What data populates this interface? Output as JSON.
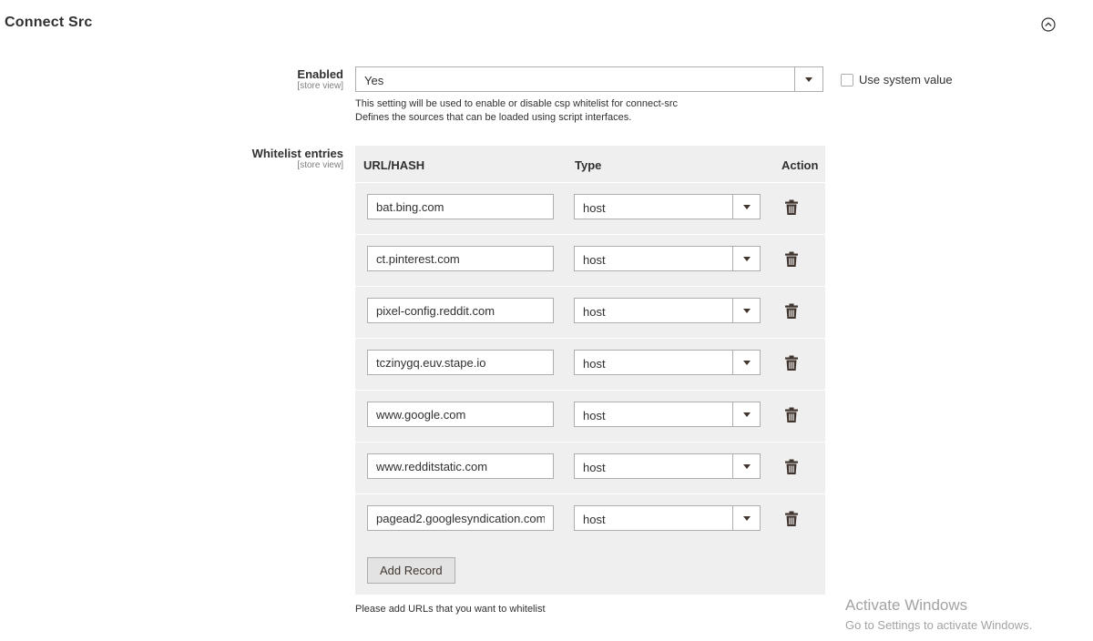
{
  "section": {
    "title": "Connect Src",
    "collapse_icon": "chevron-up-circle-icon"
  },
  "enabled_field": {
    "label": "Enabled",
    "scope": "[store view]",
    "value": "Yes",
    "use_system_value_label": "Use system value",
    "use_system_value_checked": false,
    "note_line1": "This setting will be used to enable or disable csp whitelist for connect-src",
    "note_line2": "Defines the sources that can be loaded using script interfaces."
  },
  "whitelist_field": {
    "label": "Whitelist entries",
    "scope": "[store view]",
    "columns": {
      "url": "URL/HASH",
      "type": "Type",
      "action": "Action"
    },
    "rows": [
      {
        "url": "bat.bing.com",
        "type": "host"
      },
      {
        "url": "ct.pinterest.com",
        "type": "host"
      },
      {
        "url": "pixel-config.reddit.com",
        "type": "host"
      },
      {
        "url": "tczinygq.euv.stape.io",
        "type": "host"
      },
      {
        "url": "www.google.com",
        "type": "host"
      },
      {
        "url": "www.redditstatic.com",
        "type": "host"
      },
      {
        "url": "pagead2.googlesyndication.com",
        "type": "host"
      }
    ],
    "add_button_label": "Add Record",
    "note": "Please add URLs that you want to whitelist",
    "delete_icon": "trash-icon"
  },
  "watermark": {
    "line1": "Activate Windows",
    "line2": "Go to Settings to activate Windows."
  }
}
